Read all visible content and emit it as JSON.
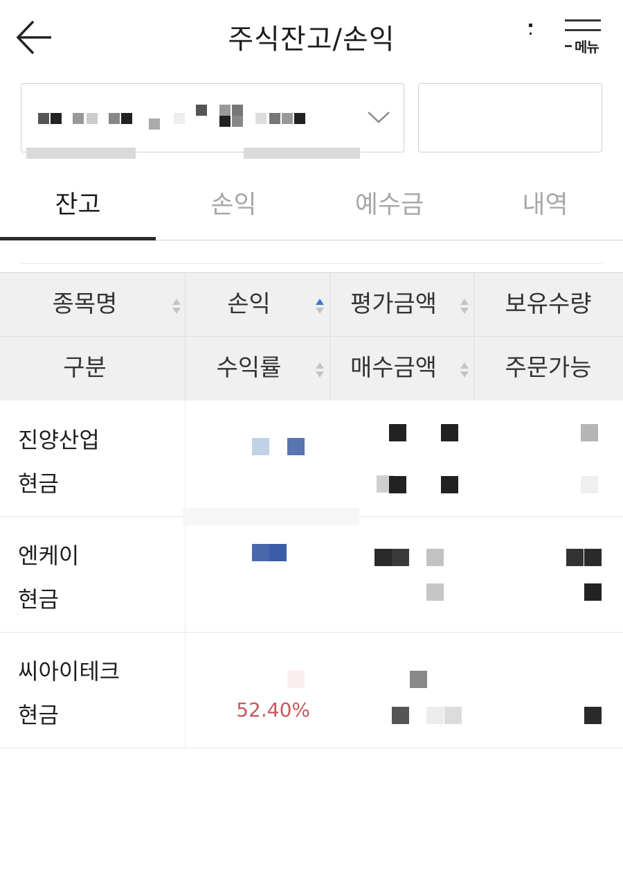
{
  "header": {
    "title": "주식잔고/손익",
    "menu_label": "메뉴"
  },
  "tabs": [
    {
      "label": "잔고",
      "active": true
    },
    {
      "label": "손익",
      "active": false
    },
    {
      "label": "예수금",
      "active": false
    },
    {
      "label": "내역",
      "active": false
    }
  ],
  "table": {
    "headers_row1": [
      "종목명",
      "손익",
      "평가금액",
      "보유수량"
    ],
    "headers_row2": [
      "구분",
      "수익률",
      "매수금액",
      "주문가능"
    ],
    "active_sort_color": "#3a7bd5",
    "rows": [
      {
        "name": "진양산업",
        "kind": "현금",
        "rate": ""
      },
      {
        "name": "엔케이",
        "kind": "현금",
        "rate": ""
      },
      {
        "name": "씨아이테크",
        "kind": "현금",
        "rate": "52.40%"
      }
    ]
  },
  "colors": {
    "profit_red": "#c9575a",
    "tab_active": "#1e1e1e",
    "tab_inactive": "#a8a8a8"
  }
}
